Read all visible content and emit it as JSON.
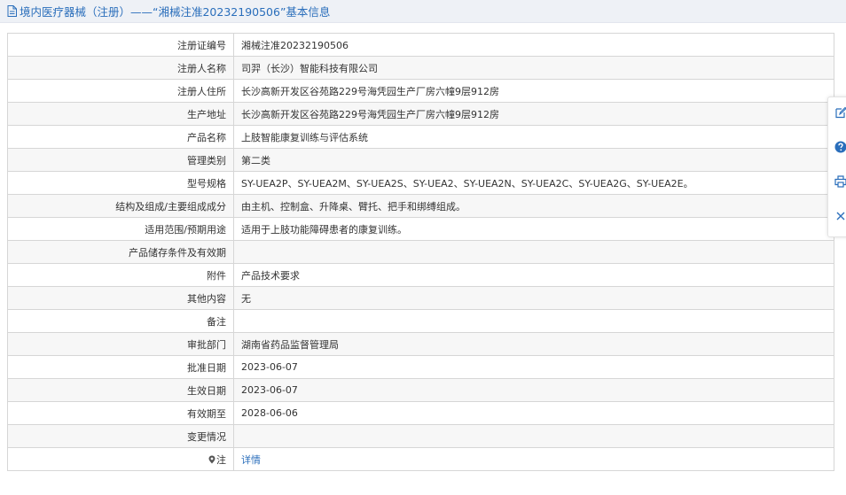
{
  "header": {
    "title": "境内医疗器械（注册）——“湘械注准20232190506”基本信息",
    "icon": "document-icon",
    "color": "#2a6ebb"
  },
  "rows": [
    {
      "label": "注册证编号",
      "value": "湘械注准20232190506"
    },
    {
      "label": "注册人名称",
      "value": "司羿（长沙）智能科技有限公司"
    },
    {
      "label": "注册人住所",
      "value": "长沙高新开发区谷苑路229号海凭园生产厂房六幢9层912房"
    },
    {
      "label": "生产地址",
      "value": "长沙高新开发区谷苑路229号海凭园生产厂房六幢9层912房"
    },
    {
      "label": "产品名称",
      "value": "上肢智能康复训练与评估系统"
    },
    {
      "label": "管理类别",
      "value": "第二类"
    },
    {
      "label": "型号规格",
      "value": "SY-UEA2P、SY-UEA2M、SY-UEA2S、SY-UEA2、SY-UEA2N、SY-UEA2C、SY-UEA2G、SY-UEA2E。"
    },
    {
      "label": "结构及组成/主要组成成分",
      "value": "由主机、控制盒、升降桌、臂托、把手和绑缚组成。"
    },
    {
      "label": "适用范围/预期用途",
      "value": "适用于上肢功能障碍患者的康复训练。"
    },
    {
      "label": "产品储存条件及有效期",
      "value": ""
    },
    {
      "label": "附件",
      "value": "产品技术要求"
    },
    {
      "label": "其他内容",
      "value": "无"
    },
    {
      "label": "备注",
      "value": ""
    },
    {
      "label": "审批部门",
      "value": "湖南省药品监督管理局"
    },
    {
      "label": "批准日期",
      "value": "2023-06-07"
    },
    {
      "label": "生效日期",
      "value": "2023-06-07"
    },
    {
      "label": "有效期至",
      "value": "2028-06-06"
    },
    {
      "label": "变更情况",
      "value": ""
    }
  ],
  "note_row": {
    "icon": "pin-icon",
    "label": "注",
    "link": "详情"
  },
  "side_toolbar": [
    "edit-icon",
    "help-icon",
    "print-icon",
    "close-icon"
  ]
}
